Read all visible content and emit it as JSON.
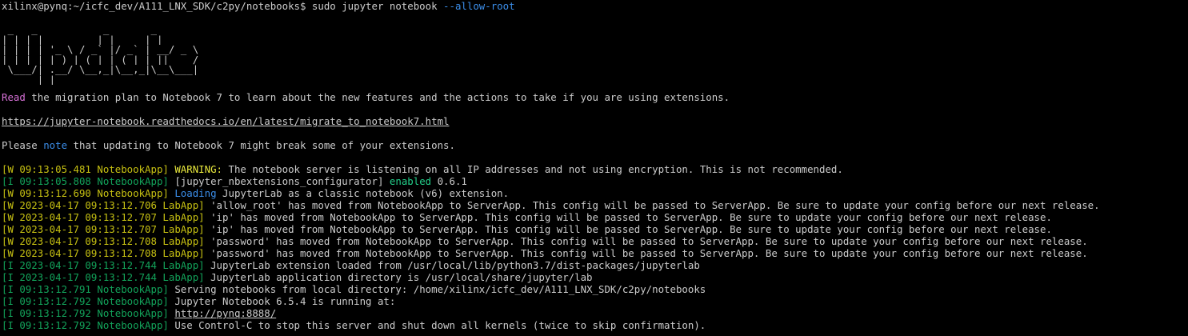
{
  "prompt": {
    "text": "xilinx@pynq:~/icfc_dev/A111_LNX_SDK/c2py/notebooks$ sudo jupyter notebook ",
    "flag": "--allow-root"
  },
  "ascii_art": [
    " _   _           _       _       ",
    "| | | |_ __   __| | __ _| |_ ___ ",
    "| | | | '_ \\ / _` |/ _` | __/ _ \\",
    "| |_| | |_) | (_| | (_| | ||  __/",
    " \\___/| .__/ \\__,_|\\__,_|\\__\\___|",
    "      |_|                        "
  ],
  "migration": {
    "read_word": "Read",
    "read_rest": " the migration plan to Notebook 7 to learn about the new features and the actions to take if you are using extensions.",
    "url": "https://jupyter-notebook.readthedocs.io/en/latest/migrate_to_notebook7.html",
    "please_1": "Please ",
    "note_word": "note",
    "please_2": " that updating to Notebook 7 might break some of your extensions."
  },
  "log": {
    "l1_prefix": "[W 09:13:05.481 NotebookApp] ",
    "l1_kw": "WARNING:",
    "l1_rest": " The notebook server is listening on all IP addresses and not using encryption. This is not recommended.",
    "l2_prefix": "[I 09:13:05.808 NotebookApp] ",
    "l2_mid": "[jupyter_nbextensions_configurator] ",
    "l2_kw": "enabled",
    "l2_rest": " 0.6.1",
    "l3_prefix": "[W 09:13:12.690 NotebookApp] ",
    "l3_kw": "Loading",
    "l3_rest": " JupyterLab as a classic notebook (v6) extension.",
    "l4_prefix": "[W 2023-04-17 09:13:12.706 LabApp] ",
    "l4_rest": "'allow_root' has moved from NotebookApp to ServerApp. This config will be passed to ServerApp. Be sure to update your config before our next release.",
    "l5_prefix": "[W 2023-04-17 09:13:12.707 LabApp] ",
    "l5_rest": "'ip' has moved from NotebookApp to ServerApp. This config will be passed to ServerApp. Be sure to update your config before our next release.",
    "l6_prefix": "[W 2023-04-17 09:13:12.707 LabApp] ",
    "l6_rest": "'ip' has moved from NotebookApp to ServerApp. This config will be passed to ServerApp. Be sure to update your config before our next release.",
    "l7_prefix": "[W 2023-04-17 09:13:12.708 LabApp] ",
    "l7_rest": "'password' has moved from NotebookApp to ServerApp. This config will be passed to ServerApp. Be sure to update your config before our next release.",
    "l8_prefix": "[W 2023-04-17 09:13:12.708 LabApp] ",
    "l8_rest": "'password' has moved from NotebookApp to ServerApp. This config will be passed to ServerApp. Be sure to update your config before our next release.",
    "l9_prefix": "[I 2023-04-17 09:13:12.744 LabApp] ",
    "l9_rest": "JupyterLab extension loaded from /usr/local/lib/python3.7/dist-packages/jupyterlab",
    "l10_prefix": "[I 2023-04-17 09:13:12.744 LabApp] ",
    "l10_rest": "JupyterLab application directory is /usr/local/share/jupyter/lab",
    "l11_prefix": "[I 09:13:12.791 NotebookApp] ",
    "l11_rest": "Serving notebooks from local directory: /home/xilinx/icfc_dev/A111_LNX_SDK/c2py/notebooks",
    "l12_prefix": "[I 09:13:12.792 NotebookApp] ",
    "l12_rest": "Jupyter Notebook 6.5.4 is running at:",
    "l13_prefix": "[I 09:13:12.792 NotebookApp] ",
    "l13_url": "http://pynq:8888/",
    "l14_prefix": "[I 09:13:12.792 NotebookApp] ",
    "l14_rest": "Use Control-C to stop this server and shut down all kernels (twice to skip confirmation)."
  }
}
